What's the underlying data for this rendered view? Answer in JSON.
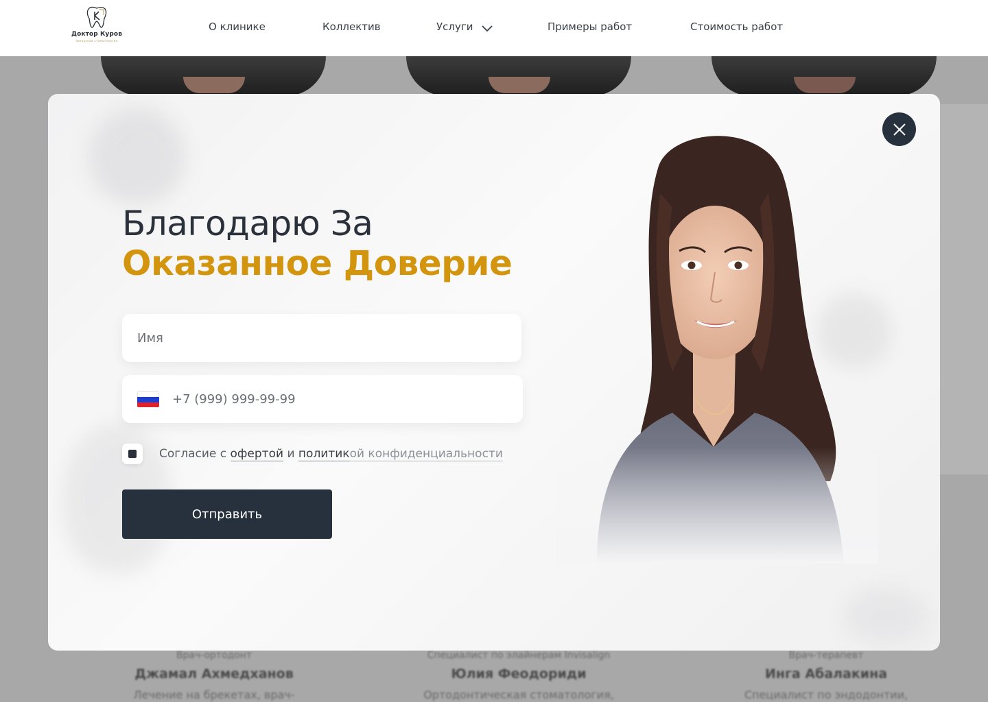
{
  "header": {
    "logo": {
      "name": "Доктор Куров",
      "subtitle": "авторская стоматология"
    },
    "nav": [
      {
        "label": "О клинике"
      },
      {
        "label": "Коллектив"
      },
      {
        "label": "Услуги"
      },
      {
        "label": "Примеры работ"
      },
      {
        "label": "Стоимость работ"
      }
    ]
  },
  "modal": {
    "title_line1": "Благодарю За",
    "title_line2": "Оказанное Доверие",
    "name_field": {
      "placeholder": "Имя",
      "value": ""
    },
    "phone_field": {
      "placeholder": "+7 (999) 999-99-99",
      "country": "RU",
      "value": ""
    },
    "consent": {
      "prefix": "Согласие с",
      "offer_link": "офертой",
      "and": "и",
      "policy_link_part1": "политик",
      "policy_link_part2": "ой конфиденциальности",
      "checked": true
    },
    "submit_label": "Отправить"
  },
  "background_page": {
    "doctors": [
      {
        "role": "Врач-ортодонт",
        "name": "Джамал Ахмедханов",
        "desc": "Лечение на брекетах, врач-"
      },
      {
        "role": "Специалист по элайнерам Invisalign",
        "name": "Юлия Феодориди",
        "desc": "Ортодонтическая стоматология,"
      },
      {
        "role": "Врач-терапевт",
        "name": "Инга Абалакина",
        "desc": "Специалист по эндодонтии,"
      }
    ]
  },
  "colors": {
    "accent_gold": "#d4950e",
    "dark_navy": "#27313d",
    "title_dark": "#2b313a"
  }
}
